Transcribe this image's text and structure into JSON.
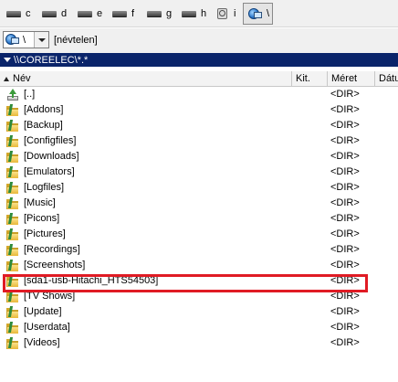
{
  "drives": [
    {
      "letter": "c",
      "icon": "hard-drive-icon",
      "active": false
    },
    {
      "letter": "d",
      "icon": "hard-drive-icon",
      "active": false
    },
    {
      "letter": "e",
      "icon": "hard-drive-icon",
      "active": false
    },
    {
      "letter": "f",
      "icon": "hard-drive-icon",
      "active": false
    },
    {
      "letter": "g",
      "icon": "hard-drive-icon",
      "active": false
    },
    {
      "letter": "h",
      "icon": "hard-drive-icon",
      "active": false
    },
    {
      "letter": "i",
      "icon": "removable-drive-icon",
      "active": false
    },
    {
      "letter": "\\",
      "icon": "network-drive-icon",
      "active": true
    }
  ],
  "path_bar": {
    "drive_value": "\\",
    "volume_label": "[névtelen]"
  },
  "current_path": "\\\\COREELEC\\*.*",
  "columns": {
    "name": "Név",
    "ext": "Kit.",
    "size": "Méret",
    "date": "Dátu"
  },
  "files": [
    {
      "name": "[..]",
      "size": "<DIR>",
      "icon": "up-directory-icon"
    },
    {
      "name": "[Addons]",
      "size": "<DIR>",
      "icon": "folder-icon"
    },
    {
      "name": "[Backup]",
      "size": "<DIR>",
      "icon": "folder-icon"
    },
    {
      "name": "[Configfiles]",
      "size": "<DIR>",
      "icon": "folder-icon"
    },
    {
      "name": "[Downloads]",
      "size": "<DIR>",
      "icon": "folder-icon"
    },
    {
      "name": "[Emulators]",
      "size": "<DIR>",
      "icon": "folder-icon"
    },
    {
      "name": "[Logfiles]",
      "size": "<DIR>",
      "icon": "folder-icon"
    },
    {
      "name": "[Music]",
      "size": "<DIR>",
      "icon": "folder-icon"
    },
    {
      "name": "[Picons]",
      "size": "<DIR>",
      "icon": "folder-icon"
    },
    {
      "name": "[Pictures]",
      "size": "<DIR>",
      "icon": "folder-icon"
    },
    {
      "name": "[Recordings]",
      "size": "<DIR>",
      "icon": "folder-icon"
    },
    {
      "name": "[Screenshots]",
      "size": "<DIR>",
      "icon": "folder-icon"
    },
    {
      "name": "[sda1-usb-Hitachi_HTS54503]",
      "size": "<DIR>",
      "icon": "folder-icon",
      "highlighted": true
    },
    {
      "name": "[TV Shows]",
      "size": "<DIR>",
      "icon": "folder-icon"
    },
    {
      "name": "[Update]",
      "size": "<DIR>",
      "icon": "folder-icon"
    },
    {
      "name": "[Userdata]",
      "size": "<DIR>",
      "icon": "folder-icon"
    },
    {
      "name": "[Videos]",
      "size": "<DIR>",
      "icon": "folder-icon"
    }
  ],
  "colors": {
    "path_header_bg": "#0a246a",
    "highlight_border": "#e01b24"
  }
}
